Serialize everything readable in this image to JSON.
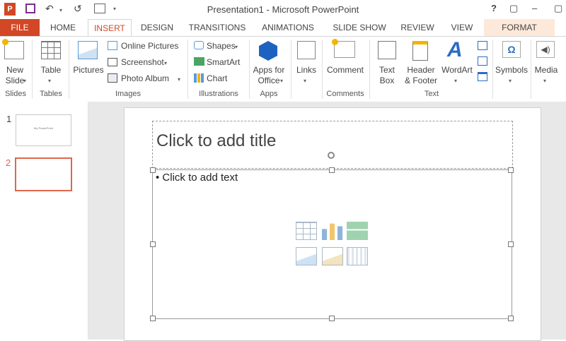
{
  "window": {
    "title": "Presentation1 - Microsoft PowerPoint"
  },
  "qat": {
    "undo_label": "↶",
    "redo_label": "↺"
  },
  "window_buttons": {
    "help": "?",
    "minimize": "–",
    "restore": "▢"
  },
  "tabs": [
    "FILE",
    "HOME",
    "INSERT",
    "DESIGN",
    "TRANSITIONS",
    "ANIMATIONS",
    "SLIDE SHOW",
    "REVIEW",
    "VIEW",
    "FORMAT"
  ],
  "ribbon": {
    "slides": {
      "new_slide": "New",
      "new_slide2": "Slide",
      "label": "Slides"
    },
    "tables": {
      "table": "Table",
      "label": "Tables"
    },
    "images": {
      "pictures": "Pictures",
      "online_pictures": "Online Pictures",
      "screenshot": "Screenshot",
      "photo_album": "Photo Album",
      "label": "Images"
    },
    "illustrations": {
      "shapes": "Shapes",
      "smartart": "SmartArt",
      "chart": "Chart",
      "label": "Illustrations"
    },
    "apps": {
      "apps_for_office": "Apps for",
      "apps_for_office2": "Office",
      "label": "Apps"
    },
    "links": {
      "links": "Links",
      "label": ""
    },
    "comments": {
      "comment": "Comment",
      "label": "Comments"
    },
    "text": {
      "text_box": "Text",
      "text_box2": "Box",
      "header_footer": "Header",
      "header_footer2": "& Footer",
      "wordart": "WordArt",
      "label": "Text"
    },
    "symbols": {
      "symbols": "Symbols"
    },
    "media": {
      "media": "Media"
    }
  },
  "slides_pane": {
    "numbers": [
      "1",
      "2"
    ],
    "thumb_title": "My PowerPoint"
  },
  "slide": {
    "title_placeholder": "Click to add title",
    "content_placeholder": "• Click to add text"
  },
  "colors": {
    "file_tab": "#d24726",
    "accent": "#d24726",
    "selected_slide": "#e0664a",
    "format_tab": "#fde9d9"
  }
}
